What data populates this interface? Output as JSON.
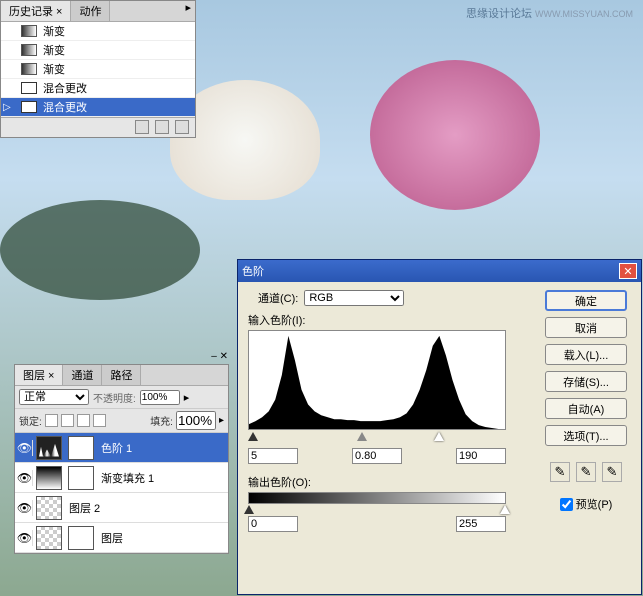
{
  "watermark": {
    "text": "思缘设计论坛",
    "url": "WWW.MISSYUAN.COM"
  },
  "history": {
    "tabs": {
      "history": "历史记录",
      "actions": "动作"
    },
    "items": [
      {
        "label": "渐变",
        "type": "gradient"
      },
      {
        "label": "渐变",
        "type": "gradient"
      },
      {
        "label": "渐变",
        "type": "gradient"
      },
      {
        "label": "混合更改",
        "type": "mix"
      },
      {
        "label": "混合更改",
        "type": "mix",
        "selected": true
      }
    ]
  },
  "layers": {
    "tabs": {
      "layers": "图层",
      "channels": "通道",
      "paths": "路径"
    },
    "blend_mode": "正常",
    "opacity_label": "不透明度:",
    "opacity": "100%",
    "lock_label": "锁定:",
    "fill_label": "填充:",
    "fill": "100%",
    "rows": [
      {
        "name": "色阶 1",
        "selected": true,
        "thumb": "histogram"
      },
      {
        "name": "渐变填充 1",
        "thumb": "gradient"
      },
      {
        "name": "图层 2",
        "thumb": "checker"
      },
      {
        "name": "图层",
        "thumb": "mask"
      }
    ]
  },
  "levels": {
    "title": "色阶",
    "channel_label": "通道(C):",
    "channel": "RGB",
    "input_label": "输入色阶(I):",
    "output_label": "输出色阶(O):",
    "input_black": "5",
    "input_gamma": "0.80",
    "input_white": "190",
    "output_black": "0",
    "output_white": "255",
    "buttons": {
      "ok": "确定",
      "cancel": "取消",
      "load": "载入(L)...",
      "save": "存储(S)...",
      "auto": "自动(A)",
      "options": "选项(T)..."
    },
    "preview_label": "预览(P)",
    "preview_checked": true
  },
  "chart_data": {
    "type": "histogram",
    "title": "输入色阶",
    "xlabel": "",
    "ylabel": "",
    "x_range": [
      0,
      255
    ],
    "values": [
      5,
      8,
      12,
      18,
      30,
      55,
      95,
      70,
      40,
      25,
      18,
      14,
      12,
      10,
      10,
      9,
      9,
      8,
      8,
      8,
      8,
      9,
      10,
      12,
      16,
      25,
      40,
      60,
      85,
      95,
      75,
      50,
      30,
      15,
      8,
      4,
      2,
      1,
      0,
      0
    ]
  }
}
